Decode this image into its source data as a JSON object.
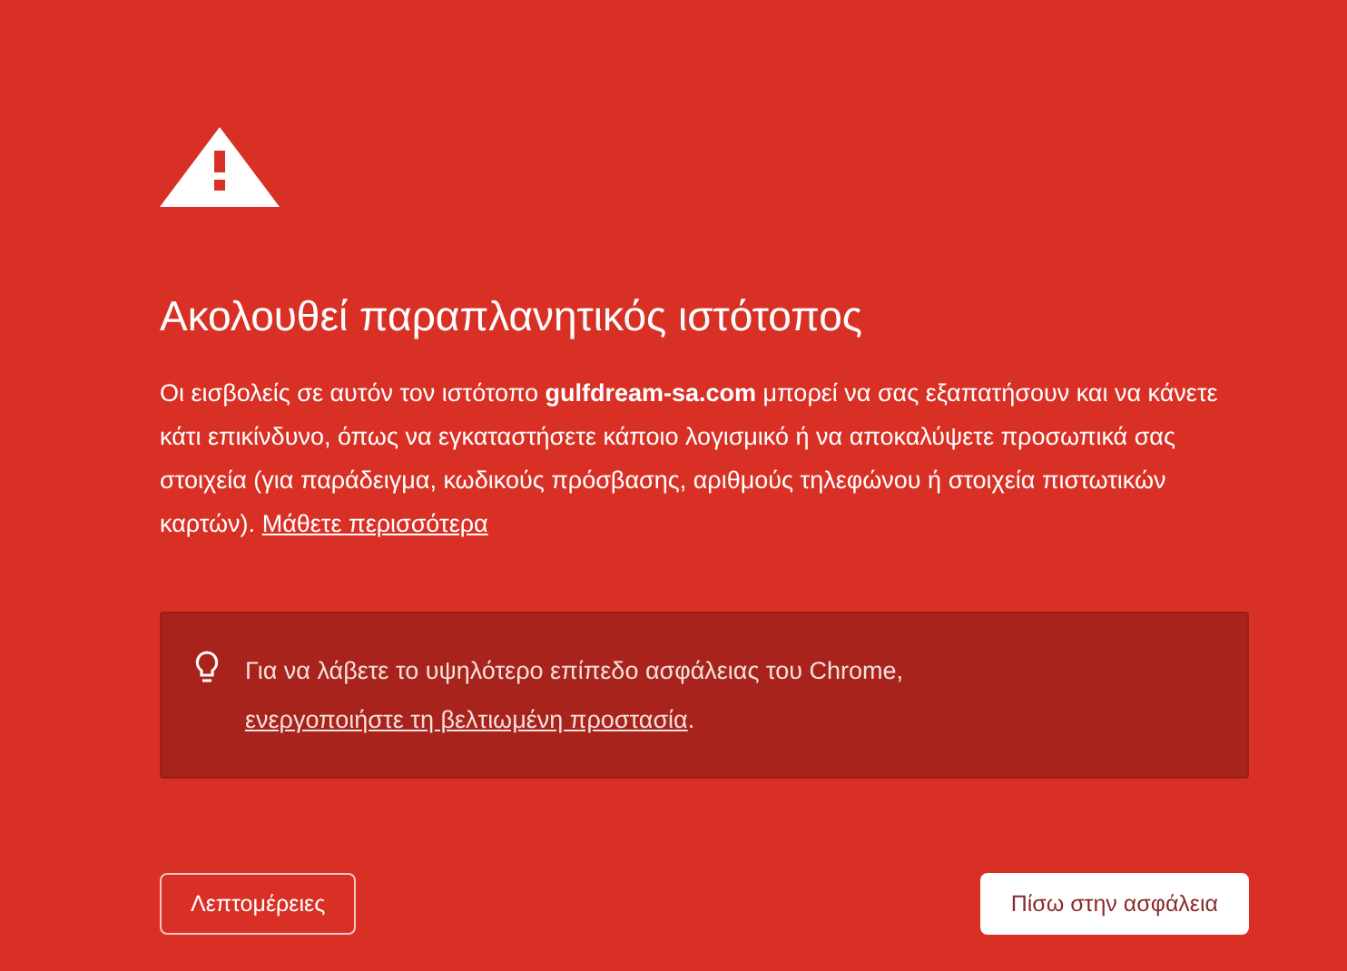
{
  "heading": "Ακολουθεί παραπλανητικός ιστότοπος",
  "message": {
    "text": "Οι εισβολείς σε αυτόν τον ιστότοπο **gulfdream-sa.com** μπορεί να σας εξαπατήσουν και να κάνετε κάτι επικίνδυνο, όπως να εγκαταστήσετε κάποιο λογισμικό ή να αποκαλύψετε προσωπικά σας στοιχεία (για παράδειγμα, κωδικούς πρόσβασης, αριθμούς τηλεφώνου ή στοιχεία πιστωτικών καρτών).",
    "link": "Μάθετε περισσότερα"
  },
  "tip": {
    "text": "Για να λάβετε το υψηλότερο επίπεδο ασφάλειας του Chrome,",
    "link": "ενεργοποιήστε τη βελτιωμένη προστασία",
    "end": "."
  },
  "buttons": [
    {
      "label": "Λεπτομέρειες",
      "kind": "secondary"
    },
    {
      "label": "Πίσω στην ασφάλεια",
      "kind": "primary"
    }
  ]
}
